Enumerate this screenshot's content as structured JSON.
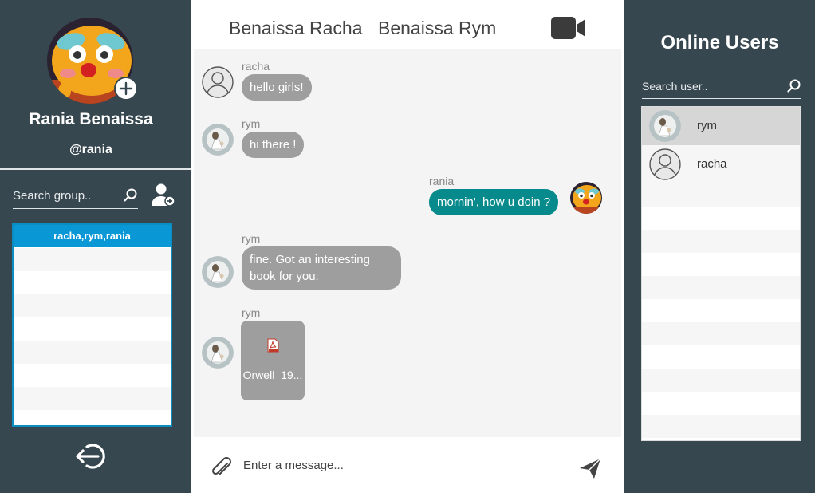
{
  "profile": {
    "name": "Rania Benaissa",
    "handle": "@rania"
  },
  "groups": {
    "search_placeholder": "Search group..",
    "items": [
      "racha,rym,rania"
    ]
  },
  "chat": {
    "members": [
      "Benaissa Racha",
      "Benaissa Rym"
    ],
    "messages": [
      {
        "sender": "racha",
        "text": "hello girls!"
      },
      {
        "sender": "rym",
        "text": "hi there !"
      },
      {
        "sender": "rania",
        "text": "mornin', how u doin ?"
      },
      {
        "sender": "rym",
        "text": "fine. Got an interesting book for you:"
      },
      {
        "sender": "rym",
        "file": "Orwell_19..."
      }
    ],
    "composer_placeholder": "Enter a message..."
  },
  "online": {
    "title": "Online Users",
    "search_placeholder": "Search user..",
    "users": [
      "rym",
      "racha"
    ]
  },
  "colors": {
    "sidebar": "#37474f",
    "accent": "#0a97d6",
    "own_bubble": "#078a8c",
    "other_bubble": "#9e9e9e"
  }
}
